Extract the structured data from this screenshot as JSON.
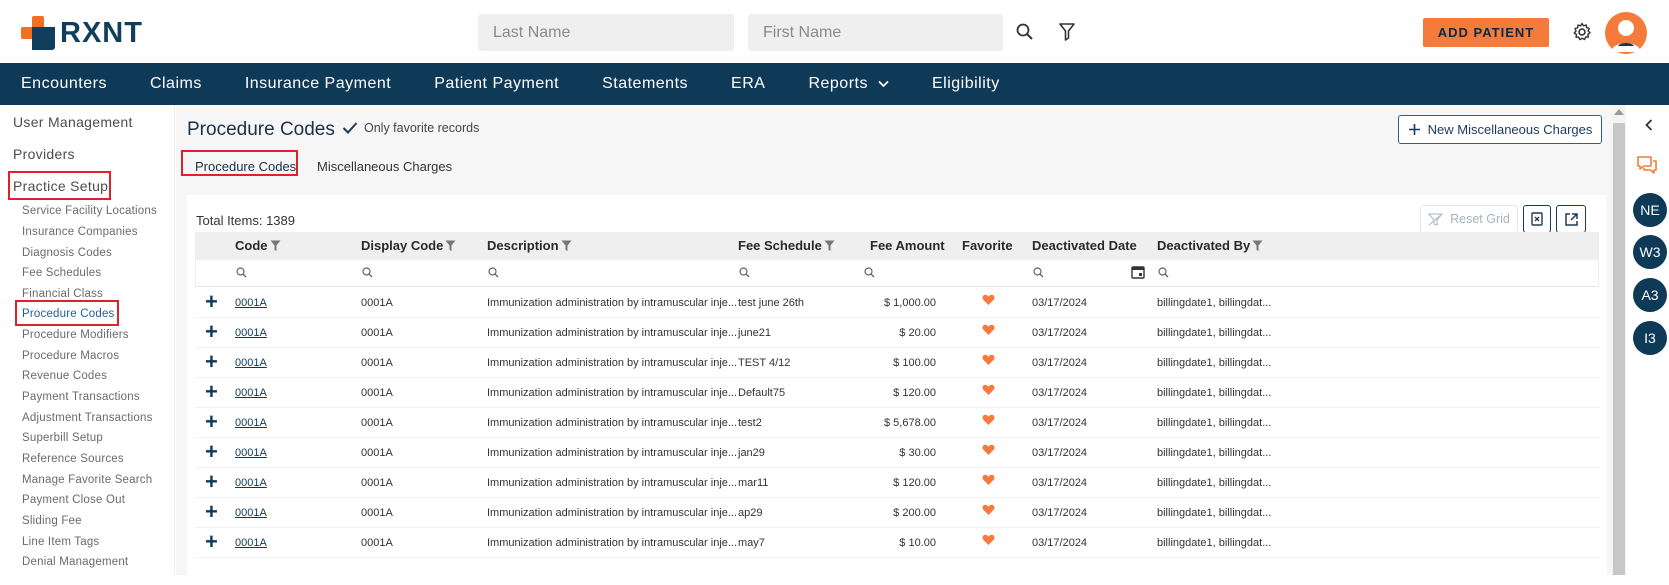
{
  "app": {
    "logo_text": "RXNT",
    "brand_orange": "#f47b3b",
    "brand_navy": "#0e3a58"
  },
  "header": {
    "last_name_placeholder": "Last Name",
    "first_name_placeholder": "First Name",
    "add_patient_label": "ADD PATIENT",
    "icons": [
      "search-icon",
      "filter-icon",
      "gear-icon",
      "user-avatar-icon"
    ]
  },
  "nav": {
    "items": [
      "Encounters",
      "Claims",
      "Insurance Payment",
      "Patient Payment",
      "Statements",
      "ERA",
      "Reports",
      "Eligibility"
    ]
  },
  "sidebar": {
    "top_items": [
      "User Management",
      "Providers",
      "Practice Setup"
    ],
    "sub_items": [
      "Service Facility Locations",
      "Insurance Companies",
      "Diagnosis Codes",
      "Fee Schedules",
      "Financial Class",
      "Procedure Codes",
      "Procedure Modifiers",
      "Procedure Macros",
      "Revenue Codes",
      "Payment Transactions",
      "Adjustment Transactions",
      "Superbill Setup",
      "Reference Sources",
      "Manage Favorite Search",
      "Payment Close Out",
      "Sliding Fee",
      "Line Item Tags",
      "Denial Management"
    ],
    "active_sub_item": "Procedure Codes"
  },
  "page": {
    "title": "Procedure Codes",
    "favorite_toggle_label": "Only favorite records",
    "favorite_checked": true,
    "new_misc_button": "New Miscellaneous Charges",
    "tabs": [
      "Procedure Codes",
      "Miscellaneous Charges"
    ],
    "active_tab": "Procedure Codes"
  },
  "grid": {
    "total_label": "Total Items: 1389",
    "reset_grid_label": "Reset Grid",
    "columns": [
      "Code",
      "Display Code",
      "Description",
      "Fee Schedule",
      "Fee Amount",
      "Favorite",
      "Deactivated Date",
      "Deactivated By"
    ],
    "rows": [
      {
        "code": "0001A",
        "display_code": "0001A",
        "description": "Immunization administration by intramuscular inje...",
        "fee_schedule": "test june 26th",
        "fee_amount": "$ 1,000.00",
        "favorite": true,
        "deactivated_date": "03/17/2024",
        "deactivated_by": "billingdate1, billingdat..."
      },
      {
        "code": "0001A",
        "display_code": "0001A",
        "description": "Immunization administration by intramuscular inje...",
        "fee_schedule": "june21",
        "fee_amount": "$ 20.00",
        "favorite": true,
        "deactivated_date": "03/17/2024",
        "deactivated_by": "billingdate1, billingdat..."
      },
      {
        "code": "0001A",
        "display_code": "0001A",
        "description": "Immunization administration by intramuscular inje...",
        "fee_schedule": "TEST 4/12",
        "fee_amount": "$ 100.00",
        "favorite": true,
        "deactivated_date": "03/17/2024",
        "deactivated_by": "billingdate1, billingdat..."
      },
      {
        "code": "0001A",
        "display_code": "0001A",
        "description": "Immunization administration by intramuscular inje...",
        "fee_schedule": "Default75",
        "fee_amount": "$ 120.00",
        "favorite": true,
        "deactivated_date": "03/17/2024",
        "deactivated_by": "billingdate1, billingdat..."
      },
      {
        "code": "0001A",
        "display_code": "0001A",
        "description": "Immunization administration by intramuscular inje...",
        "fee_schedule": "test2",
        "fee_amount": "$ 5,678.00",
        "favorite": true,
        "deactivated_date": "03/17/2024",
        "deactivated_by": "billingdate1, billingdat..."
      },
      {
        "code": "0001A",
        "display_code": "0001A",
        "description": "Immunization administration by intramuscular inje...",
        "fee_schedule": "jan29",
        "fee_amount": "$ 30.00",
        "favorite": true,
        "deactivated_date": "03/17/2024",
        "deactivated_by": "billingdate1, billingdat..."
      },
      {
        "code": "0001A",
        "display_code": "0001A",
        "description": "Immunization administration by intramuscular inje...",
        "fee_schedule": "mar11",
        "fee_amount": "$ 120.00",
        "favorite": true,
        "deactivated_date": "03/17/2024",
        "deactivated_by": "billingdate1, billingdat..."
      },
      {
        "code": "0001A",
        "display_code": "0001A",
        "description": "Immunization administration by intramuscular inje...",
        "fee_schedule": "ap29",
        "fee_amount": "$ 200.00",
        "favorite": true,
        "deactivated_date": "03/17/2024",
        "deactivated_by": "billingdate1, billingdat..."
      },
      {
        "code": "0001A",
        "display_code": "0001A",
        "description": "Immunization administration by intramuscular inje...",
        "fee_schedule": "may7",
        "fee_amount": "$ 10.00",
        "favorite": true,
        "deactivated_date": "03/17/2024",
        "deactivated_by": "billingdate1, billingdat..."
      }
    ]
  },
  "right_rail": {
    "badges": [
      "NE",
      "W3",
      "A3",
      "I3"
    ]
  }
}
